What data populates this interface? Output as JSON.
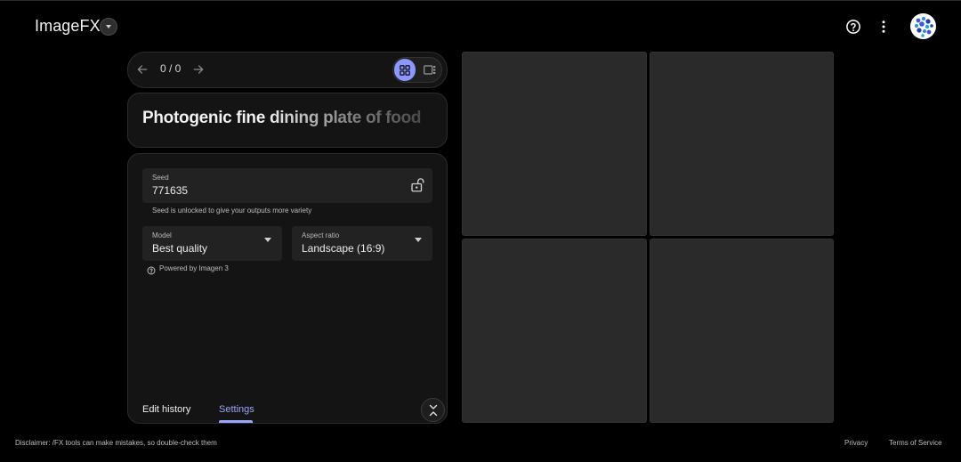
{
  "header": {
    "app_title": "ImageFX",
    "help_icon": "help-circle-icon",
    "menu_icon": "more-vert-icon",
    "avatar_icon": "user-avatar"
  },
  "navigator": {
    "counter": "0 / 0",
    "view_mode": "grid"
  },
  "prompt": {
    "text": "Photogenic fine dining plate of food"
  },
  "settings": {
    "seed": {
      "label": "Seed",
      "value": "771635",
      "hint": "Seed is unlocked to give your outputs more variety",
      "icon": "unlock-icon"
    },
    "model": {
      "label": "Model",
      "value": "Best quality",
      "powered_by": "Powered by Imagen 3"
    },
    "aspect_ratio": {
      "label": "Aspect ratio",
      "value": "Landscape (16:9)"
    },
    "tabs": [
      {
        "label": "Edit history",
        "active": false
      },
      {
        "label": "Settings",
        "active": true
      }
    ]
  },
  "footer": {
    "disclaimer": "Disclaimer: /FX tools can make mistakes, so double-check them",
    "privacy": "Privacy",
    "terms": "Terms of Service"
  },
  "colors": {
    "background": "#000000",
    "panel": "#141414",
    "accent": "#9aa4ff",
    "tile": "#2a2a2a"
  }
}
